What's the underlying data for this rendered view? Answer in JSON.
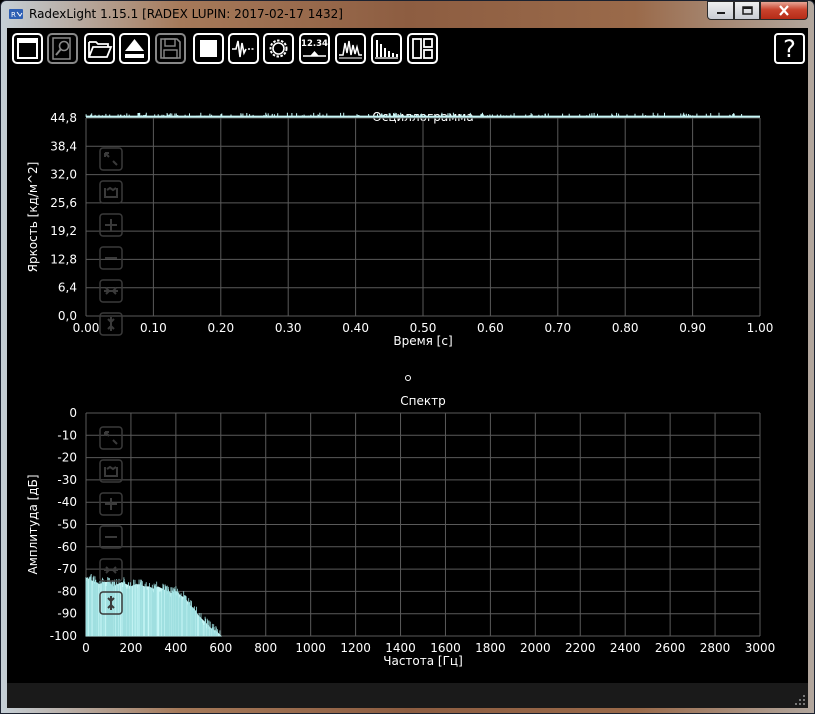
{
  "window": {
    "title": "RadexLight 1.15.1 [RADEX LUPIN: 2017-02-17 1432]"
  },
  "toolbar": {
    "buttons": [
      {
        "icon": "window-icon"
      },
      {
        "icon": "zoom-icon"
      },
      {
        "icon": "folder-open-icon"
      },
      {
        "icon": "eject-icon"
      },
      {
        "icon": "save-icon"
      },
      {
        "icon": "stop-icon"
      },
      {
        "icon": "oscillogram-icon"
      },
      {
        "icon": "settings-gear-icon"
      },
      {
        "icon": "measurement-value-icon",
        "label": "12.34"
      },
      {
        "icon": "waveform-icon"
      },
      {
        "icon": "spectrum-bars-icon"
      },
      {
        "icon": "layout-icon"
      }
    ],
    "help_label": "?"
  },
  "chart_data": [
    {
      "type": "area",
      "title": "Осциллограмма",
      "xlabel": "Время [с]",
      "ylabel": "Яркость [кд/м^2]",
      "xlim": [
        0,
        1
      ],
      "ylim": [
        0,
        44.8
      ],
      "x_ticks": [
        "0.00",
        "0.10",
        "0.20",
        "0.30",
        "0.40",
        "0.50",
        "0.60",
        "0.70",
        "0.80",
        "0.90",
        "1.00"
      ],
      "y_ticks": [
        "0,0",
        "6,4",
        "12,8",
        "19,2",
        "25,6",
        "32,0",
        "38,4",
        "44,8"
      ],
      "series": [
        {
          "x": [
            0,
            1
          ],
          "values": [
            45.1,
            45.1
          ],
          "color": "#c8f7f7"
        }
      ],
      "grid": true
    },
    {
      "type": "area",
      "title": "Спектр",
      "xlabel": "Частота [Гц]",
      "ylabel": "Амплитуда [дБ]",
      "xlim": [
        0,
        3000
      ],
      "ylim": [
        -100,
        0
      ],
      "x_ticks": [
        "0",
        "200",
        "400",
        "600",
        "800",
        "1000",
        "1200",
        "1400",
        "1600",
        "1800",
        "2000",
        "2200",
        "2400",
        "2600",
        "2800",
        "3000"
      ],
      "y_ticks": [
        "0",
        "-10",
        "-20",
        "-30",
        "-40",
        "-50",
        "-60",
        "-70",
        "-80",
        "-90",
        "-100"
      ],
      "series": [
        {
          "x": [
            0,
            20,
            40,
            60,
            80,
            100,
            120,
            140,
            160,
            180,
            200,
            220,
            240,
            260,
            280,
            300,
            320,
            340,
            360,
            380,
            400,
            420,
            440,
            460,
            480,
            500,
            520,
            540,
            560,
            580,
            600
          ],
          "values": [
            -74,
            -75,
            -76,
            -77,
            -76,
            -76,
            -78,
            -77,
            -76,
            -77,
            -78,
            -77,
            -77,
            -78,
            -78,
            -79,
            -78,
            -79,
            -80,
            -81,
            -80,
            -82,
            -83,
            -86,
            -88,
            -91,
            -93,
            -95,
            -97,
            -98,
            -100
          ],
          "color": "#c8f7f7"
        }
      ],
      "grid": true
    }
  ],
  "colors": {
    "plot_background": "#000000",
    "grid": "#5a5a5a",
    "axis_text": "#ffffff",
    "series": "#c8f7f7"
  }
}
